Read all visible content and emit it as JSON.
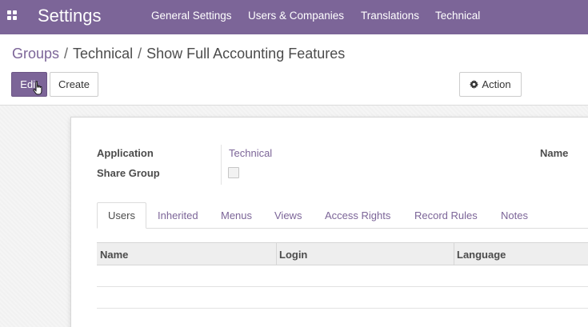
{
  "app": {
    "title": "Settings"
  },
  "top_menu": {
    "items": [
      "General Settings",
      "Users & Companies",
      "Translations",
      "Technical"
    ]
  },
  "breadcrumb": {
    "items": [
      "Groups",
      "Technical",
      "Show Full Accounting Features"
    ],
    "separator": "/"
  },
  "control_panel": {
    "edit_label": "Edit",
    "create_label": "Create",
    "action_label": "Action"
  },
  "form": {
    "application_label": "Application",
    "application_value": "Technical",
    "share_group_label": "Share Group",
    "share_group_checked": false,
    "name_label": "Name"
  },
  "tabs": {
    "items": [
      "Users",
      "Inherited",
      "Menus",
      "Views",
      "Access Rights",
      "Record Rules",
      "Notes"
    ],
    "active": "Users"
  },
  "table": {
    "columns": [
      "Name",
      "Login",
      "Language"
    ],
    "rows": []
  },
  "colors": {
    "brand": "#7c6598",
    "link": "#7c6598",
    "text": "#4c4c4c"
  }
}
